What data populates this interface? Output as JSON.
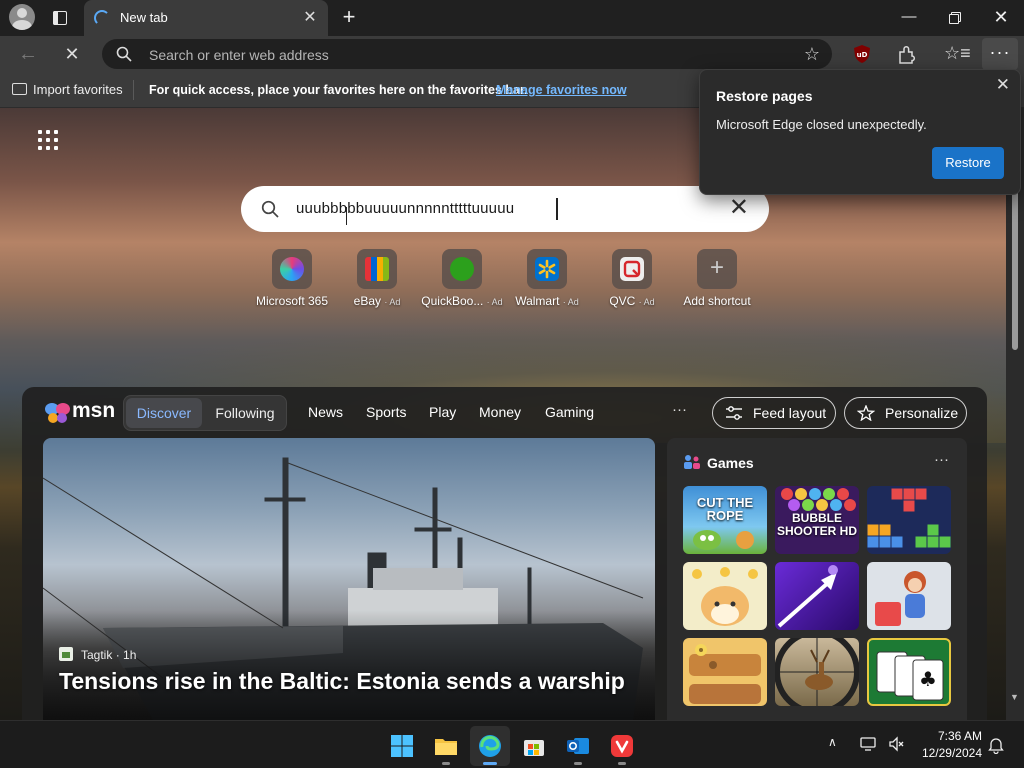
{
  "browser": {
    "tab_title": "New tab",
    "address_placeholder": "Search or enter web address",
    "ublock_badge": "uD"
  },
  "favorites_bar": {
    "import_label": "Import favorites",
    "message": "For quick access, place your favorites here on the favorites bar.",
    "manage_link": "Manage favorites now"
  },
  "restore_popup": {
    "title": "Restore pages",
    "message": "Microsoft Edge closed unexpectedly.",
    "button": "Restore"
  },
  "ntp": {
    "search_value": "uuubbbbbuuuuunnnnntttttuuuuu",
    "shortcuts": [
      {
        "label": "Microsoft 365",
        "ad": "",
        "icon": "microsoft-365-icon",
        "color": "#5b7fe8"
      },
      {
        "label": "eBay",
        "ad": "· Ad",
        "icon": "ebay-icon",
        "color": "#2c2c2c"
      },
      {
        "label": "QuickBoo...",
        "ad": "· Ad",
        "icon": "quickbooks-icon",
        "color": "#2ca01c"
      },
      {
        "label": "Walmart",
        "ad": "· Ad",
        "icon": "walmart-icon",
        "color": "#0071ce"
      },
      {
        "label": "QVC",
        "ad": "· Ad",
        "icon": "qvc-icon",
        "color": "#e8e8e8"
      },
      {
        "label": "Add shortcut",
        "ad": "",
        "icon": "plus-icon",
        "color": ""
      }
    ]
  },
  "feed": {
    "brand": "msn",
    "tabs": [
      "Discover",
      "Following"
    ],
    "nav": [
      "News",
      "Sports",
      "Play",
      "Money",
      "Gaming"
    ],
    "more": "···",
    "feed_layout": "Feed layout",
    "personalize": "Personalize",
    "hero": {
      "source": "Tagtik",
      "age": "· 1h",
      "headline": "Tensions rise in the Baltic: Estonia sends a warship"
    },
    "games": {
      "title": "Games",
      "more": "···",
      "tiles": [
        {
          "name": "Cut the Rope",
          "label": "CUT THE ROPE"
        },
        {
          "name": "Bubble Shooter HD",
          "label": "BUBBLE SHOOTER HD"
        },
        {
          "name": "Block Puzzle",
          "label": ""
        },
        {
          "name": "Shiba Memory",
          "label": ""
        },
        {
          "name": "Speed Bump",
          "label": ""
        },
        {
          "name": "Home Makeover",
          "label": ""
        },
        {
          "name": "Wood Nuts",
          "label": ""
        },
        {
          "name": "Deer Hunter",
          "label": ""
        },
        {
          "name": "Solitaire",
          "label": ""
        }
      ]
    }
  },
  "taskbar": {
    "apps": [
      "Windows Start",
      "File Explorer",
      "Microsoft Edge",
      "Microsoft Store",
      "Outlook",
      "Vivaldi"
    ],
    "time": "7:36 AM",
    "date": "12/29/2024"
  },
  "colors": {
    "accent": "#1a73c8",
    "link": "#74b9ff",
    "tab_selected": "#8ab9ff"
  }
}
